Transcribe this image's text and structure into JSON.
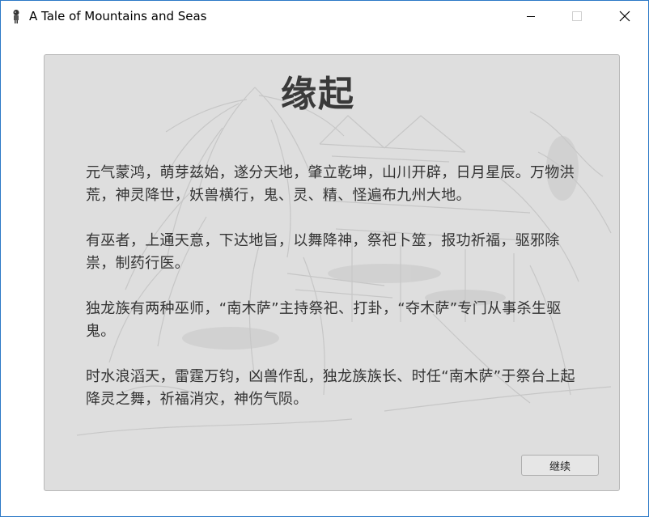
{
  "window": {
    "title": "A Tale of Mountains and Seas",
    "icon": "app-figure-icon",
    "controls": [
      "minimize-icon",
      "maximize-icon",
      "close-icon"
    ]
  },
  "panel": {
    "heading": "缘起",
    "paragraphs": [
      "元气蒙鸿，萌芽兹始，遂分天地，肇立乾坤，山川开辟，日月星辰。万物洪荒，神灵降世，妖兽横行，鬼、灵、精、怪遍布九州大地。",
      "有巫者，上通天意，下达地旨，以舞降神，祭祀卜筮，报功祈福，驱邪除祟，制药行医。",
      "独龙族有两种巫师，“南木萨”主持祭祀、打卦，“夺木萨”专门从事杀生驱鬼。",
      "时水浪滔天，雷霆万钧，凶兽作乱，独龙族族长、时任“南木萨”于祭台上起降灵之舞，祈福消灾，神伤气陨。"
    ],
    "continue_label": "继续"
  },
  "colors": {
    "panel_bg": "#dedede",
    "text": "#333333",
    "heading": "#3a3a3a",
    "window_border": "#2b78c6"
  }
}
